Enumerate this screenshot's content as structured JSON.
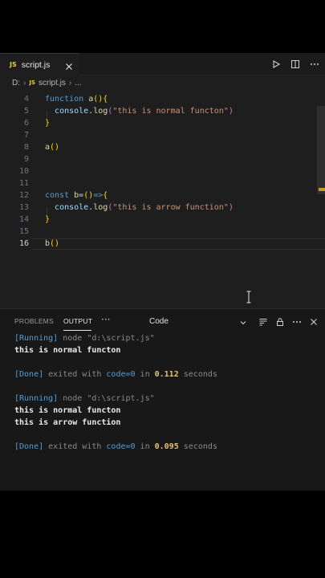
{
  "tab": {
    "badge": "JS",
    "label": "script.js"
  },
  "breadcrumb": {
    "drive": "D:",
    "file": "script.js",
    "more": "..."
  },
  "editor": {
    "lines": [
      {
        "n": "4",
        "tokens": [
          [
            "kw",
            "function "
          ],
          [
            "fn",
            "a"
          ],
          [
            "br1",
            "()"
          ],
          [
            "br1",
            "{"
          ]
        ]
      },
      {
        "n": "5",
        "tokens": [
          [
            "pun",
            "  "
          ],
          [
            "var",
            "console"
          ],
          [
            "pun",
            "."
          ],
          [
            "fn",
            "log"
          ],
          [
            "br2",
            "("
          ],
          [
            "str",
            "\"this is normal functon\""
          ],
          [
            "br2",
            ")"
          ]
        ]
      },
      {
        "n": "6",
        "tokens": [
          [
            "br1",
            "}"
          ]
        ]
      },
      {
        "n": "7",
        "tokens": []
      },
      {
        "n": "8",
        "tokens": [
          [
            "fn",
            "a"
          ],
          [
            "br1",
            "()"
          ]
        ]
      },
      {
        "n": "9",
        "tokens": []
      },
      {
        "n": "10",
        "tokens": []
      },
      {
        "n": "11",
        "tokens": []
      },
      {
        "n": "12",
        "tokens": [
          [
            "kw",
            "const "
          ],
          [
            "fn",
            "b"
          ],
          [
            "pun",
            "="
          ],
          [
            "br1",
            "()"
          ],
          [
            "kw",
            "=>"
          ],
          [
            "br1",
            "{"
          ]
        ]
      },
      {
        "n": "13",
        "tokens": [
          [
            "pun",
            "  "
          ],
          [
            "var",
            "console"
          ],
          [
            "pun",
            "."
          ],
          [
            "fn",
            "log"
          ],
          [
            "br2",
            "("
          ],
          [
            "str",
            "\"this is arrow function\""
          ],
          [
            "br2",
            ")"
          ]
        ]
      },
      {
        "n": "14",
        "tokens": [
          [
            "br1",
            "}"
          ]
        ]
      },
      {
        "n": "15",
        "tokens": []
      },
      {
        "n": "16",
        "tokens": [
          [
            "fn",
            "b"
          ],
          [
            "br1",
            "()"
          ]
        ]
      }
    ],
    "active_line": "16"
  },
  "panel": {
    "tabs": [
      "PROBLEMS",
      "OUTPUT"
    ],
    "more": "···",
    "select_value": "Code"
  },
  "output": [
    [
      [
        "o-tag",
        "[Running] "
      ],
      [
        "o-cmt",
        "node \"d:\\script.js\""
      ]
    ],
    [
      [
        "o-plain",
        "this is normal functon"
      ]
    ],
    [],
    [
      [
        "o-tag",
        "[Done] "
      ],
      [
        "o-cmt",
        "exited with "
      ],
      [
        "o-tag",
        "code=0"
      ],
      [
        "o-cmt",
        " in "
      ],
      [
        "o-num",
        "0.112"
      ],
      [
        "o-cmt",
        " seconds"
      ]
    ],
    [],
    [
      [
        "o-tag",
        "[Running] "
      ],
      [
        "o-cmt",
        "node \"d:\\script.js\""
      ]
    ],
    [
      [
        "o-plain",
        "this is normal functon"
      ]
    ],
    [
      [
        "o-plain",
        "this is arrow function"
      ]
    ],
    [],
    [
      [
        "o-tag",
        "[Done] "
      ],
      [
        "o-cmt",
        "exited with "
      ],
      [
        "o-tag",
        "code=0"
      ],
      [
        "o-cmt",
        " in "
      ],
      [
        "o-num",
        "0.095"
      ],
      [
        "o-cmt",
        " seconds"
      ]
    ]
  ],
  "colors": {
    "keyword": "#569cd6",
    "function": "#dcdcaa",
    "variable": "#9cdcfe",
    "string": "#ce9178",
    "bracket_gold": "#ffd700",
    "bracket_pink": "#da70d6",
    "js_badge": "#e6c94b"
  }
}
